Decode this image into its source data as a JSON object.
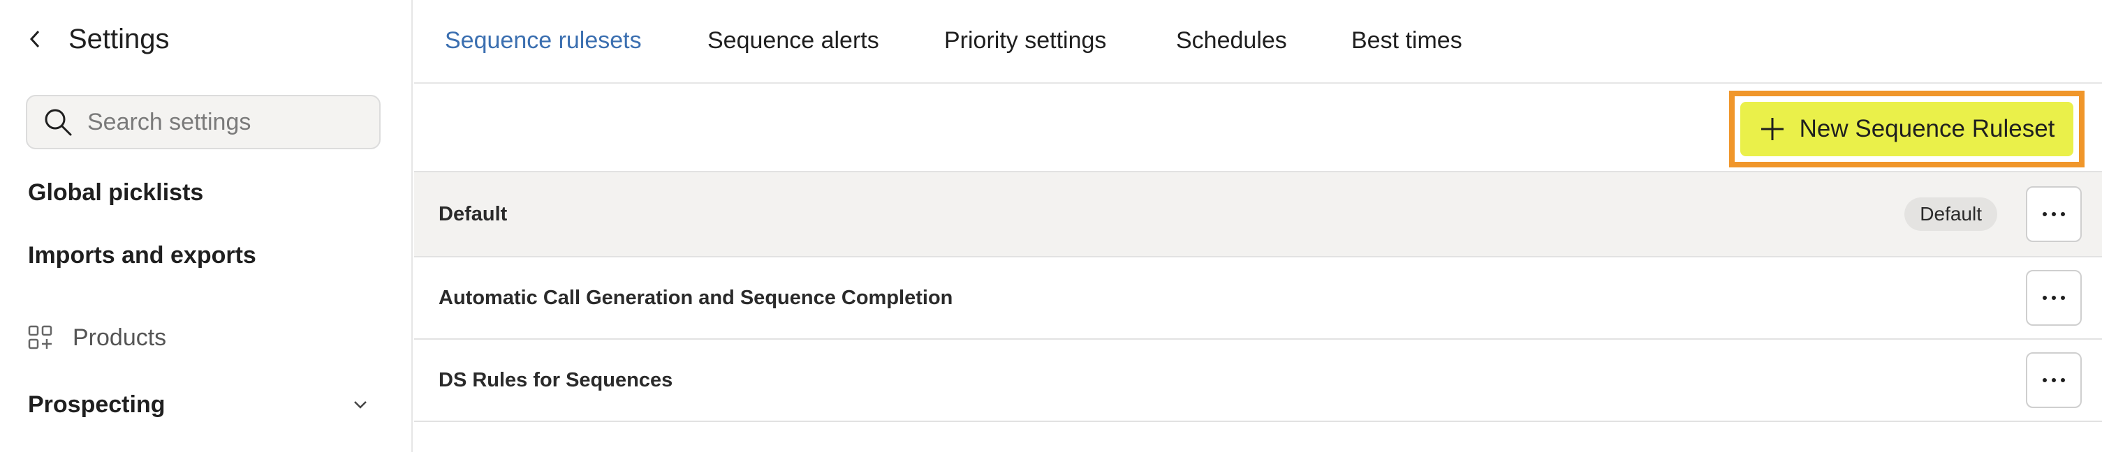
{
  "sidebar": {
    "title": "Settings",
    "search": {
      "placeholder": "Search settings",
      "value": ""
    },
    "items": [
      {
        "label": "Global picklists"
      },
      {
        "label": "Imports and exports"
      }
    ],
    "products": {
      "label": "Products",
      "icon": "grid-plus-icon"
    },
    "prospecting": {
      "label": "Prospecting",
      "icon": "chevron-down-icon"
    }
  },
  "tabs": [
    {
      "label": "Sequence rulesets",
      "active": true
    },
    {
      "label": "Sequence alerts",
      "active": false
    },
    {
      "label": "Priority settings",
      "active": false
    },
    {
      "label": "Schedules",
      "active": false
    },
    {
      "label": "Best times",
      "active": false
    }
  ],
  "toolbar": {
    "new_button_label": "New Sequence Ruleset",
    "accent_color": "#eaf04a",
    "highlight_color": "#f0962a"
  },
  "rulesets": [
    {
      "name": "Default",
      "badge": "Default"
    },
    {
      "name": "Automatic Call Generation and Sequence Completion",
      "badge": ""
    },
    {
      "name": "DS Rules for Sequences",
      "badge": ""
    }
  ],
  "colors": {
    "active_tab": "#3b6fb0",
    "row_highlight": "#f3f2f0"
  }
}
